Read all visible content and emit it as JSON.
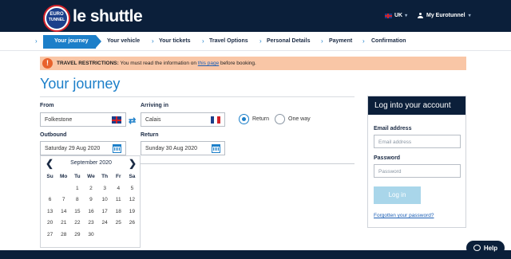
{
  "header": {
    "logo_top": "EURO",
    "logo_bottom": "TUNNEL",
    "brand": "le shuttle",
    "language": "UK",
    "account_label": "My Eurotunnel"
  },
  "steps": [
    {
      "label": "Your journey",
      "active": true
    },
    {
      "label": "Your vehicle"
    },
    {
      "label": "Your tickets"
    },
    {
      "label": "Travel Options"
    },
    {
      "label": "Personal Details"
    },
    {
      "label": "Payment"
    },
    {
      "label": "Confirmation"
    }
  ],
  "alert": {
    "icon": "!",
    "bold": "TRAVEL RESTRICTIONS:",
    "text_before": "You must read the information on",
    "link": "this page",
    "text_after": "before booking."
  },
  "page_title": "Your journey",
  "form": {
    "from_label": "From",
    "from_value": "Folkestone",
    "arriving_label": "Arriving in",
    "arriving_value": "Calais",
    "outbound_label": "Outbound",
    "outbound_value": "Saturday 29 Aug 2020",
    "return_label": "Return",
    "return_value": "Sunday 30 Aug 2020",
    "radio_return": "Return",
    "radio_oneway": "One way",
    "selected_trip": "Return"
  },
  "calendar": {
    "prev": "❮",
    "next": "❯",
    "month": "September 2020",
    "weekdays": [
      "Su",
      "Mo",
      "Tu",
      "We",
      "Th",
      "Fr",
      "Sa"
    ],
    "days": [
      "",
      "",
      "1",
      "2",
      "3",
      "4",
      "5",
      "6",
      "7",
      "8",
      "9",
      "10",
      "11",
      "12",
      "13",
      "14",
      "15",
      "16",
      "17",
      "18",
      "19",
      "20",
      "21",
      "22",
      "23",
      "24",
      "25",
      "26",
      "27",
      "28",
      "29",
      "30",
      "",
      "",
      ""
    ]
  },
  "login": {
    "title": "Log into your account",
    "email_label": "Email address",
    "email_placeholder": "Email address",
    "password_label": "Password",
    "password_placeholder": "Password",
    "button": "Log in",
    "forgot": "Forgotten your password?"
  },
  "help": {
    "label": "Help"
  },
  "colors": {
    "navy": "#0b1f3a",
    "accent_blue": "#1c7fc9",
    "alert_bg": "#f9c6a6",
    "alert_icon": "#e8622c",
    "login_button": "#a9d6ea",
    "flag_fr": [
      "#1b3f8b",
      "#ffffff",
      "#d3222a"
    ]
  },
  "icons": {
    "swap": "swap-arrows-icon",
    "calendar": "calendar-icon",
    "user": "user-icon",
    "help": "chat-bubble-icon"
  }
}
